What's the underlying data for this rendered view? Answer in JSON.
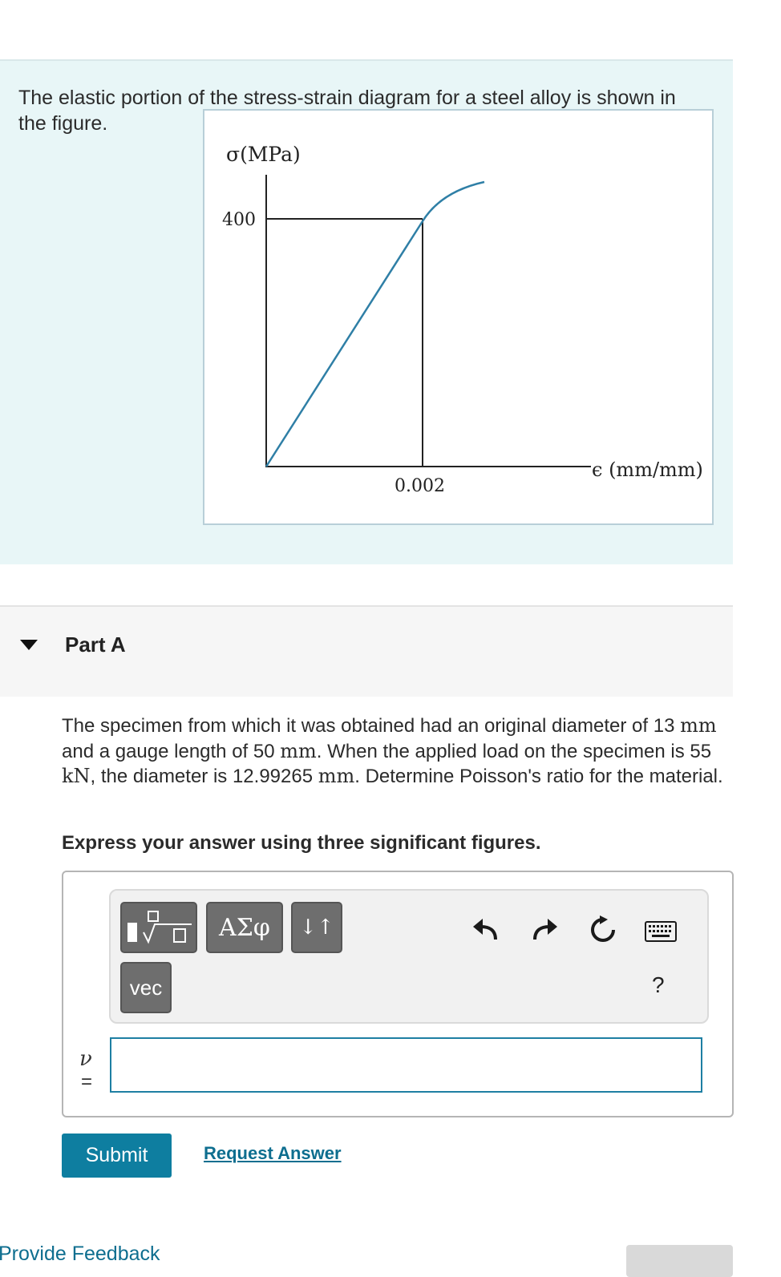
{
  "intro": {
    "text": "The elastic portion of the stress-strain diagram for a steel alloy is shown in the figure."
  },
  "figure": {
    "y_axis_label": "σ(MPa)",
    "x_axis_label": "ϵ (mm/mm)",
    "y_tick": "400",
    "x_tick": "0.002",
    "curve_color": "#2f7fa6",
    "yield_stress": 400,
    "yield_strain": 0.002
  },
  "part": {
    "label": "Part A"
  },
  "question": {
    "p1": "The specimen from which it was obtained had an original diameter of 13",
    "u1": "mm",
    "p2": " and a gauge length of 50 ",
    "u2": "mm",
    "p3": ". When the applied load on the specimen is 55 ",
    "u3": "kN",
    "p4": ", the diameter is 12.99265 ",
    "u4": "mm",
    "p5": ". Determine Poisson's ratio for the material.",
    "instruction": "Express your answer using three significant figures."
  },
  "toolbar": {
    "template_icon": "fraction-sqrt-template-icon",
    "greek_label": "ΑΣφ",
    "arrows_label": "↓↑",
    "vec_label": "vec",
    "undo_icon": "undo-icon",
    "redo_icon": "redo-icon",
    "reset_icon": "reset-icon",
    "keyboard_icon": "keyboard-icon",
    "help_label": "?"
  },
  "answer": {
    "variable": "ν",
    "equals": "=",
    "value": ""
  },
  "actions": {
    "submit_label": "Submit",
    "request_label": "Request Answer",
    "feedback_label": "Provide Feedback"
  },
  "colors": {
    "accent": "#0e7ea0",
    "intro_bg": "#e8f6f7",
    "input_border": "#1e7fa3"
  }
}
